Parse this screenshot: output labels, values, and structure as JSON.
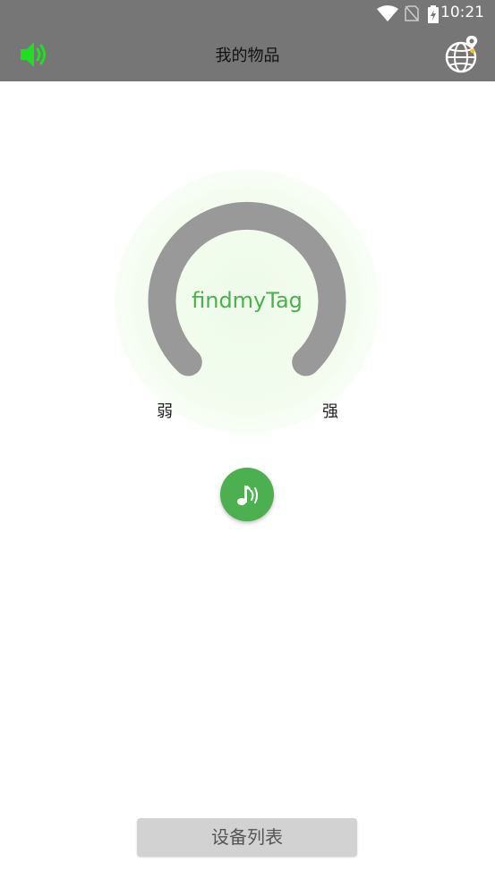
{
  "status_bar": {
    "time": "10:21"
  },
  "header": {
    "title": "我的物品",
    "sound_icon": "speaker-volume-icon",
    "globe_icon": "globe-location-icon"
  },
  "signal": {
    "device_name": "findmyTag",
    "weak_label": "弱",
    "strong_label": "强"
  },
  "ring_button": {
    "icon": "music-note-sound-icon"
  },
  "footer": {
    "device_list_label": "设备列表"
  },
  "colors": {
    "accent_green": "#4CAF50",
    "appbar_gray": "#767676",
    "gauge_gray": "#999999",
    "glow_green": "#F1FCEE",
    "button_gray": "#D2D2D2"
  }
}
